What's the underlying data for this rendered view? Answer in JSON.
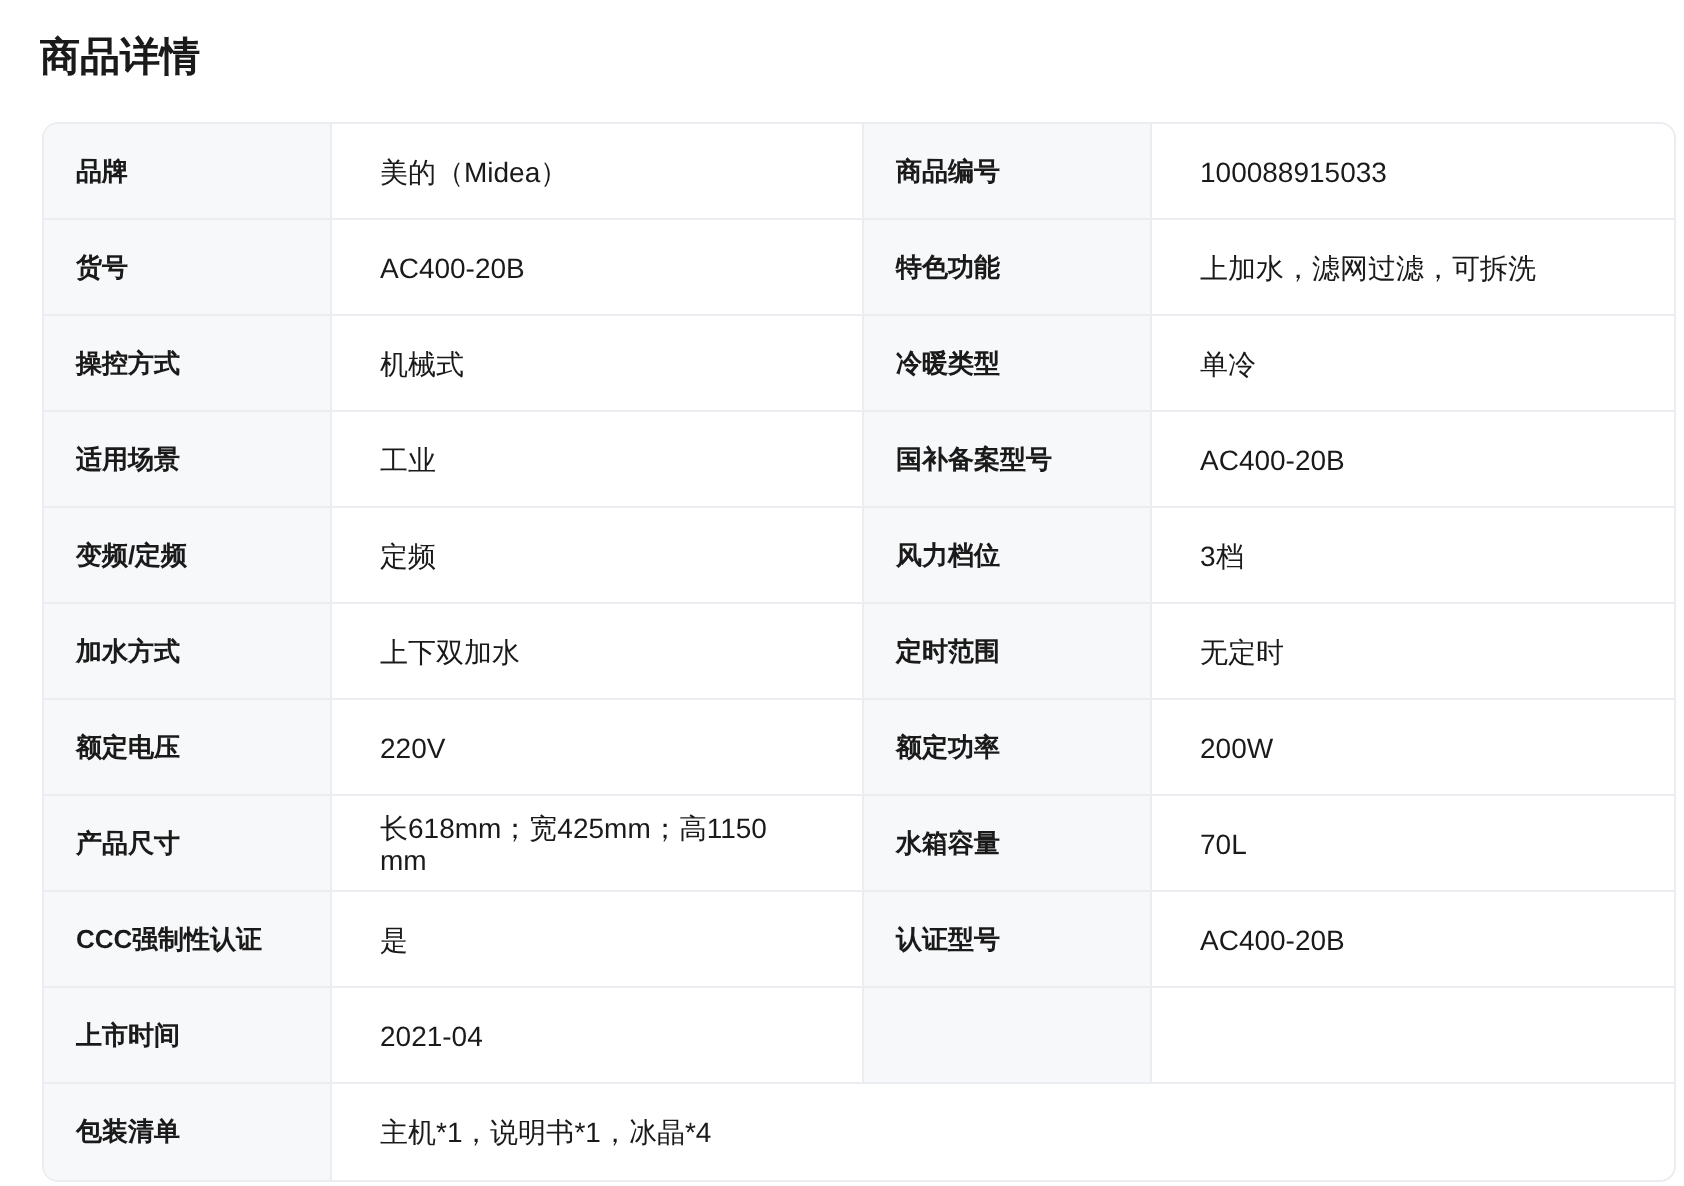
{
  "title": "商品详情",
  "rows": [
    {
      "kind": "pair",
      "pairs": [
        {
          "label": "品牌",
          "value": "美的（Midea）"
        },
        {
          "label": "商品编号",
          "value": "100088915033"
        }
      ]
    },
    {
      "kind": "pair",
      "pairs": [
        {
          "label": "货号",
          "value": "AC400-20B"
        },
        {
          "label": "特色功能",
          "value": "上加水，滤网过滤，可拆洗"
        }
      ]
    },
    {
      "kind": "pair",
      "pairs": [
        {
          "label": "操控方式",
          "value": "机械式"
        },
        {
          "label": "冷暖类型",
          "value": "单冷"
        }
      ]
    },
    {
      "kind": "pair",
      "pairs": [
        {
          "label": "适用场景",
          "value": "工业"
        },
        {
          "label": "国补备案型号",
          "value": "AC400-20B"
        }
      ]
    },
    {
      "kind": "pair",
      "pairs": [
        {
          "label": "变频/定频",
          "value": "定频"
        },
        {
          "label": "风力档位",
          "value": "3档"
        }
      ]
    },
    {
      "kind": "pair",
      "pairs": [
        {
          "label": "加水方式",
          "value": "上下双加水"
        },
        {
          "label": "定时范围",
          "value": "无定时"
        }
      ]
    },
    {
      "kind": "pair",
      "pairs": [
        {
          "label": "额定电压",
          "value": "220V"
        },
        {
          "label": "额定功率",
          "value": "200W"
        }
      ]
    },
    {
      "kind": "pair",
      "pairs": [
        {
          "label": "产品尺寸",
          "value": "长618mm；宽425mm；高1150 mm"
        },
        {
          "label": "水箱容量",
          "value": "70L"
        }
      ]
    },
    {
      "kind": "pair",
      "pairs": [
        {
          "label": "CCC强制性认证",
          "value": "是"
        },
        {
          "label": "认证型号",
          "value": "AC400-20B"
        }
      ]
    },
    {
      "kind": "pair",
      "pairs": [
        {
          "label": "上市时间",
          "value": "2021-04"
        }
      ]
    },
    {
      "kind": "full",
      "pairs": [
        {
          "label": "包装清单",
          "value": "主机*1，说明书*1，冰晶*4"
        }
      ]
    }
  ]
}
